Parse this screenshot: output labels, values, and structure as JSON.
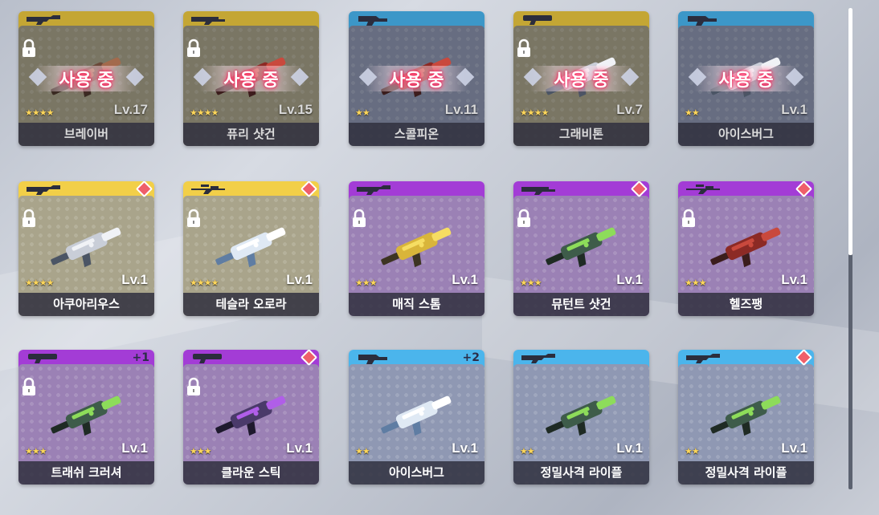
{
  "equipped_label": "사용 중",
  "colors": {
    "gold": "#f2cf48",
    "blue": "#4bb5ec",
    "purple": "#a33cd6",
    "badge": "#ef5f6a"
  },
  "cards": [
    {
      "name": "브레이버",
      "level": "Lv.17",
      "stars": "★★★★",
      "tier": "gold",
      "equipped": true,
      "type": "rifle-icon",
      "plus": "",
      "new": false,
      "locked": true,
      "weapon": "brown"
    },
    {
      "name": "퓨리 샷건",
      "level": "Lv.15",
      "stars": "★★★★",
      "tier": "gold",
      "equipped": true,
      "type": "shotgun-icon",
      "plus": "",
      "new": false,
      "locked": true,
      "weapon": "red"
    },
    {
      "name": "스콜피온",
      "level": "Lv.11",
      "stars": "★★",
      "tier": "blue",
      "equipped": true,
      "type": "pistol-icon",
      "plus": "",
      "new": false,
      "locked": false,
      "weapon": "red"
    },
    {
      "name": "그래비톤",
      "level": "Lv.7",
      "stars": "★★★★",
      "tier": "gold",
      "equipped": true,
      "type": "launcher-icon",
      "plus": "",
      "new": false,
      "locked": true,
      "weapon": "silver"
    },
    {
      "name": "아이스버그",
      "level": "Lv.1",
      "stars": "★★",
      "tier": "blue",
      "equipped": true,
      "type": "pistol-icon",
      "plus": "",
      "new": false,
      "locked": false,
      "weapon": "silver"
    },
    {
      "name": "아쿠아리우스",
      "level": "Lv.1",
      "stars": "★★★★",
      "tier": "gold",
      "equipped": false,
      "type": "rifle-icon",
      "plus": "",
      "new": true,
      "locked": true,
      "weapon": "silver"
    },
    {
      "name": "테슬라 오로라",
      "level": "Lv.1",
      "stars": "★★★★",
      "tier": "gold",
      "equipped": false,
      "type": "sniper-icon",
      "plus": "",
      "new": true,
      "locked": true,
      "weapon": "white"
    },
    {
      "name": "매직 스톰",
      "level": "Lv.1",
      "stars": "★★★",
      "tier": "purple",
      "equipped": false,
      "type": "rifle-icon",
      "plus": "",
      "new": false,
      "locked": true,
      "weapon": "gold"
    },
    {
      "name": "뮤턴트 샷건",
      "level": "Lv.1",
      "stars": "★★★",
      "tier": "purple",
      "equipped": false,
      "type": "shotgun-icon",
      "plus": "",
      "new": true,
      "locked": true,
      "weapon": "green"
    },
    {
      "name": "헬즈팽",
      "level": "Lv.1",
      "stars": "★★★",
      "tier": "purple",
      "equipped": false,
      "type": "sniper-icon",
      "plus": "",
      "new": true,
      "locked": true,
      "weapon": "red"
    },
    {
      "name": "트래쉬 크러셔",
      "level": "Lv.1",
      "stars": "★★★",
      "tier": "purple",
      "equipped": false,
      "type": "launcher-icon",
      "plus": "+1",
      "new": false,
      "locked": true,
      "weapon": "green"
    },
    {
      "name": "클라운 스틱",
      "level": "Lv.1",
      "stars": "★★★",
      "tier": "purple",
      "equipped": false,
      "type": "launcher-icon",
      "plus": "",
      "new": true,
      "locked": true,
      "weapon": "purple"
    },
    {
      "name": "아이스버그",
      "level": "Lv.1",
      "stars": "★★",
      "tier": "blue",
      "equipped": false,
      "type": "pistol-icon",
      "plus": "+2",
      "new": false,
      "locked": false,
      "weapon": "white"
    },
    {
      "name": "정밀사격 라이플",
      "level": "Lv.1",
      "stars": "★★",
      "tier": "blue",
      "equipped": false,
      "type": "rifle-icon",
      "plus": "",
      "new": false,
      "locked": false,
      "weapon": "green"
    },
    {
      "name": "정밀사격 라이플",
      "level": "Lv.1",
      "stars": "★★",
      "tier": "blue",
      "equipped": false,
      "type": "rifle-icon",
      "plus": "",
      "new": true,
      "locked": false,
      "weapon": "green"
    }
  ]
}
